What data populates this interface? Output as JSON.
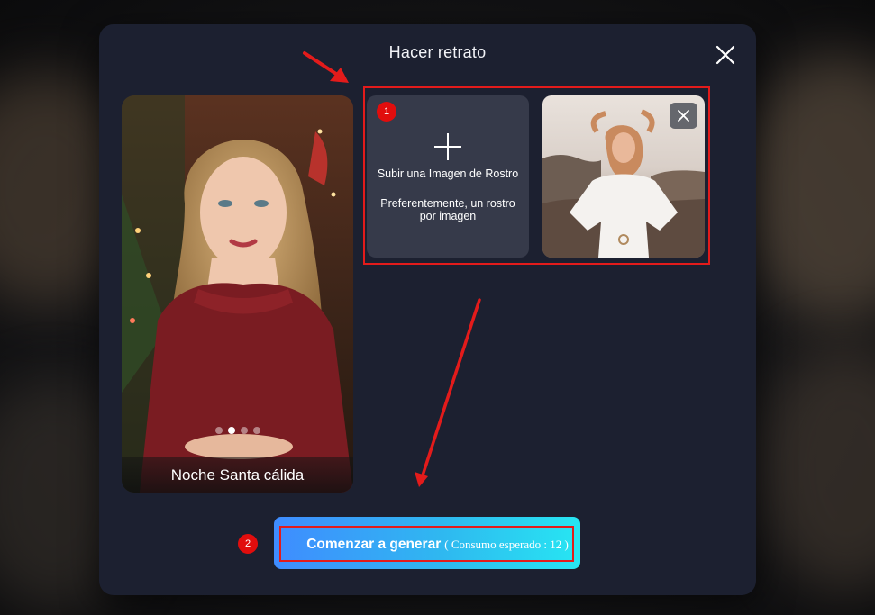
{
  "modal": {
    "title": "Hacer retrato",
    "close_icon": "close-icon"
  },
  "preview": {
    "caption": "Noche Santa cálida",
    "carousel": {
      "total": 4,
      "active_index": 1
    }
  },
  "upload": {
    "icon": "plus-icon",
    "line1": "Subir una Imagen de Rostro",
    "line2": "Preferentemente, un rostro por imagen"
  },
  "uploaded_photo": {
    "remove_icon": "close-icon"
  },
  "generate": {
    "label": "Comenzar a generar",
    "consumption": "( Consumo esperado : 12 )"
  },
  "annotations": {
    "step1": "1",
    "step2": "2",
    "color": "#e31b1b"
  },
  "colors": {
    "modal_bg": "#1c2030",
    "upload_card_bg": "#363a4a",
    "button_gradient_start": "#3f8cff",
    "button_gradient_end": "#27e6f2"
  }
}
